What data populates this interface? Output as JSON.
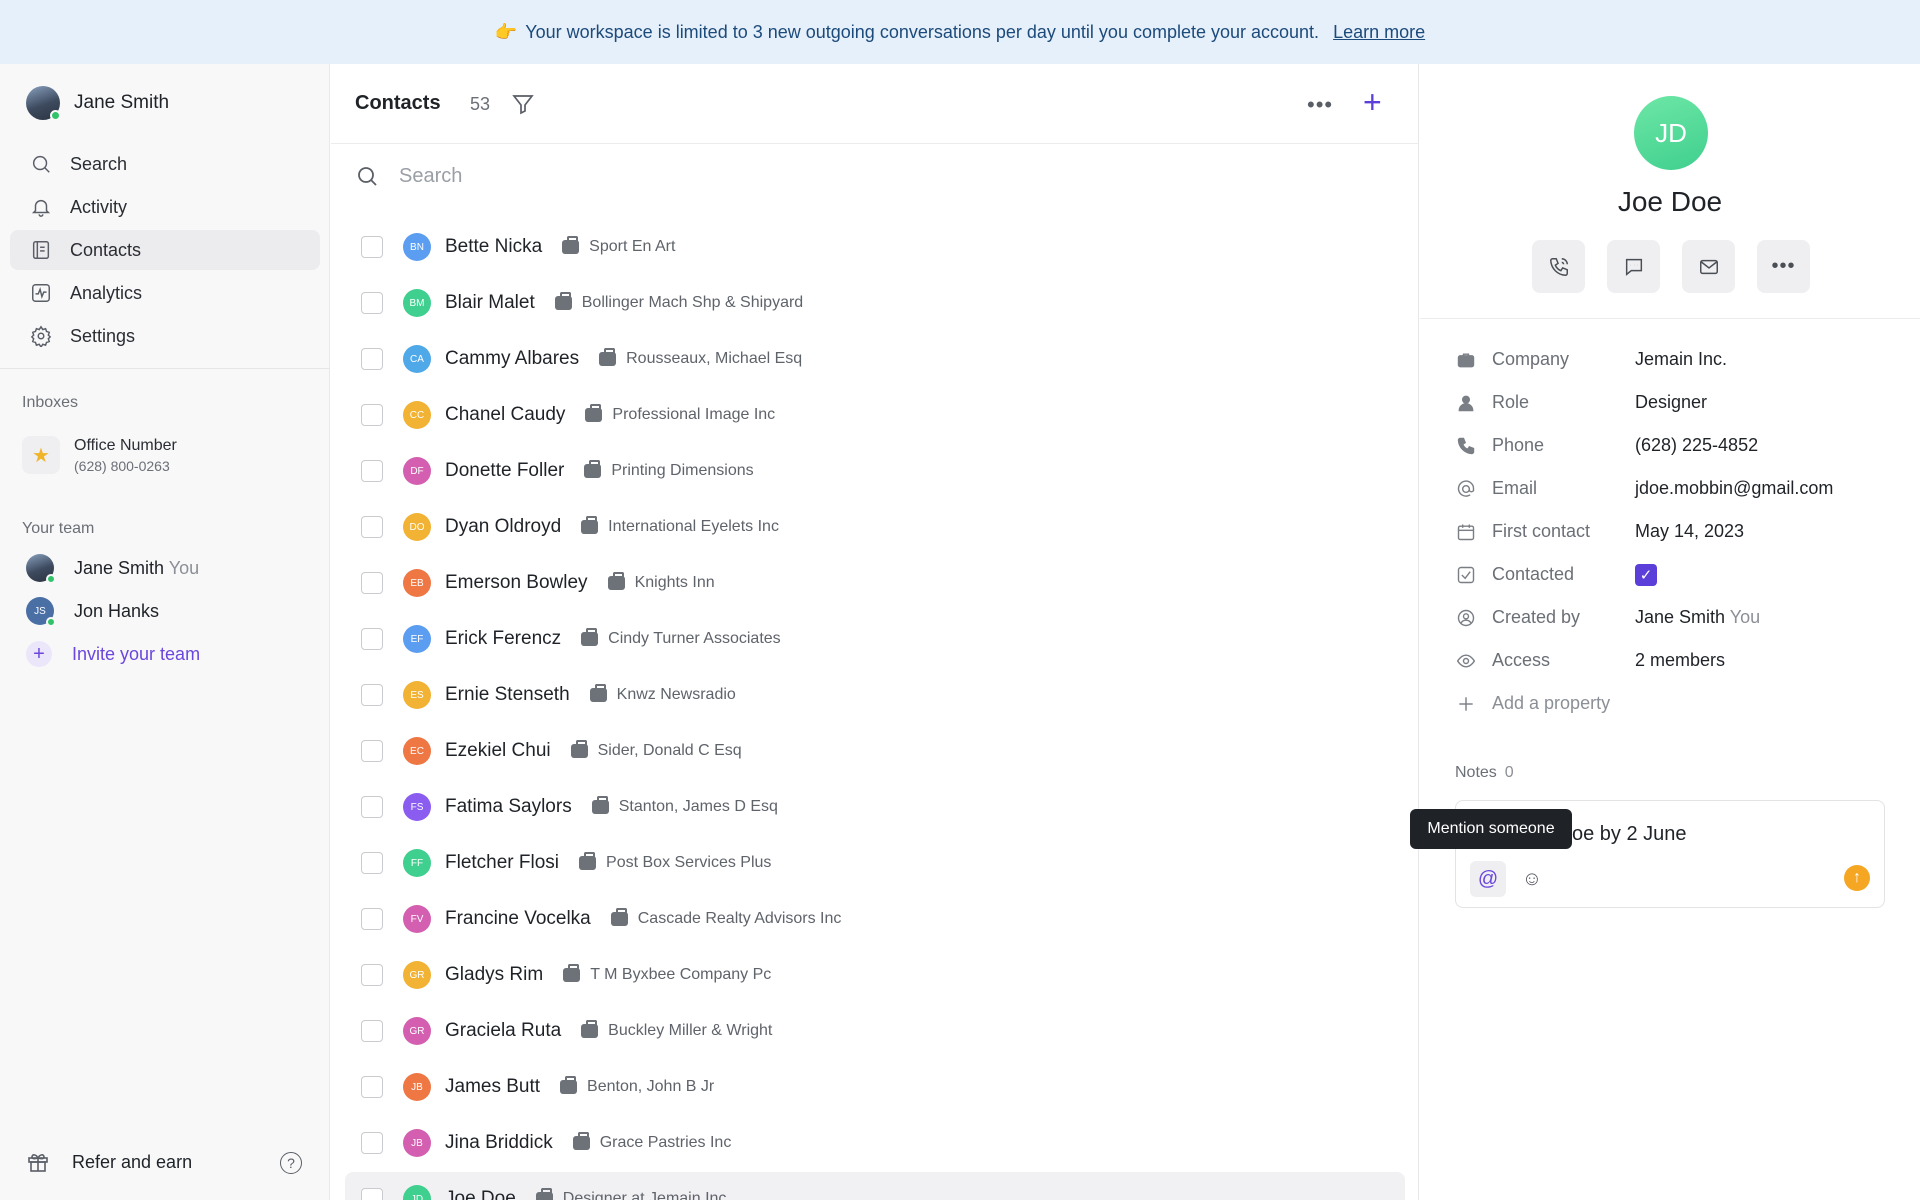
{
  "banner": {
    "emoji": "👉",
    "message": "Your workspace is limited to 3 new outgoing conversations per day until you complete your account.",
    "link": "Learn more"
  },
  "user": {
    "name": "Jane Smith"
  },
  "nav": [
    {
      "label": "Search",
      "icon": "search-icon"
    },
    {
      "label": "Activity",
      "icon": "bell-icon"
    },
    {
      "label": "Contacts",
      "icon": "contacts-icon",
      "active": true
    },
    {
      "label": "Analytics",
      "icon": "analytics-icon"
    },
    {
      "label": "Settings",
      "icon": "gear-icon"
    }
  ],
  "inboxes": {
    "label": "Inboxes",
    "items": [
      {
        "title": "Office Number",
        "number": "(628) 800-0263",
        "icon": "star-icon"
      }
    ]
  },
  "team": {
    "label": "Your team",
    "members": [
      {
        "name": "Jane Smith",
        "suffix": "You"
      },
      {
        "name": "Jon Hanks",
        "initials": "JS"
      }
    ],
    "invite": "Invite your team"
  },
  "footer": {
    "refer": "Refer and earn",
    "help": "?"
  },
  "contacts": {
    "title": "Contacts",
    "count": "53",
    "search_placeholder": "Search",
    "rows": [
      {
        "initials": "BN",
        "name": "Bette Nicka",
        "company": "Sport En Art",
        "color": "#5b9df0"
      },
      {
        "initials": "BM",
        "name": "Blair Malet",
        "company": "Bollinger Mach Shp & Shipyard",
        "color": "#3fcf8e"
      },
      {
        "initials": "CA",
        "name": "Cammy Albares",
        "company": "Rousseaux, Michael Esq",
        "color": "#4fa8e8"
      },
      {
        "initials": "CC",
        "name": "Chanel Caudy",
        "company": "Professional Image Inc",
        "color": "#f2b233"
      },
      {
        "initials": "DF",
        "name": "Donette Foller",
        "company": "Printing Dimensions",
        "color": "#d45fb0"
      },
      {
        "initials": "DO",
        "name": "Dyan Oldroyd",
        "company": "International Eyelets Inc",
        "color": "#f2b233"
      },
      {
        "initials": "EB",
        "name": "Emerson Bowley",
        "company": "Knights Inn",
        "color": "#ee7744"
      },
      {
        "initials": "EF",
        "name": "Erick Ferencz",
        "company": "Cindy Turner Associates",
        "color": "#5b9df0"
      },
      {
        "initials": "ES",
        "name": "Ernie Stenseth",
        "company": "Knwz Newsradio",
        "color": "#f2b233"
      },
      {
        "initials": "EC",
        "name": "Ezekiel Chui",
        "company": "Sider, Donald C Esq",
        "color": "#ee7744"
      },
      {
        "initials": "FS",
        "name": "Fatima Saylors",
        "company": "Stanton, James D Esq",
        "color": "#8a5cf0"
      },
      {
        "initials": "FF",
        "name": "Fletcher Flosi",
        "company": "Post Box Services Plus",
        "color": "#3fcf8e"
      },
      {
        "initials": "FV",
        "name": "Francine Vocelka",
        "company": "Cascade Realty Advisors Inc",
        "color": "#d45fb0"
      },
      {
        "initials": "GR",
        "name": "Gladys Rim",
        "company": "T M Byxbee Company Pc",
        "color": "#f2b233"
      },
      {
        "initials": "GR",
        "name": "Graciela Ruta",
        "company": "Buckley Miller & Wright",
        "color": "#d45fb0"
      },
      {
        "initials": "JB",
        "name": "James Butt",
        "company": "Benton, John B Jr",
        "color": "#ee7744"
      },
      {
        "initials": "JB",
        "name": "Jina Briddick",
        "company": "Grace Pastries Inc",
        "color": "#d45fb0"
      },
      {
        "initials": "JD",
        "name": "Joe Doe",
        "company": "Designer at Jemain Inc.",
        "color": "#3fcf8e",
        "selected": true
      }
    ]
  },
  "detail": {
    "initials": "JD",
    "name": "Joe Doe",
    "properties": [
      {
        "label": "Company",
        "value": "Jemain Inc.",
        "icon": "briefcase-icon"
      },
      {
        "label": "Role",
        "value": "Designer",
        "icon": "person-icon"
      },
      {
        "label": "Phone",
        "value": "(628) 225-4852",
        "icon": "phone-icon"
      },
      {
        "label": "Email",
        "value": "jdoe.mobbin@gmail.com",
        "icon": "at-icon"
      },
      {
        "label": "First contact",
        "value": "May 14, 2023",
        "icon": "calendar-icon"
      },
      {
        "label": "Contacted",
        "value": "",
        "checked": true,
        "icon": "checkbox-icon"
      },
      {
        "label": "Created by",
        "value": "Jane Smith",
        "suffix": "You",
        "icon": "user-circle-icon"
      },
      {
        "label": "Access",
        "value": "2 members",
        "icon": "eye-icon"
      }
    ],
    "add_property": "Add a property",
    "notes": {
      "label": "Notes",
      "count": "0",
      "draft": "oe by 2 June"
    },
    "tooltip": "Mention someone"
  }
}
